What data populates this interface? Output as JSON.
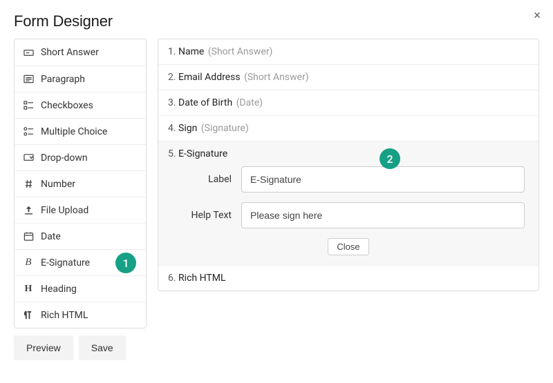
{
  "title": "Form Designer",
  "badges": {
    "one": "1",
    "two": "2"
  },
  "palette": [
    {
      "icon": "short-answer",
      "label": "Short Answer"
    },
    {
      "icon": "paragraph",
      "label": "Paragraph"
    },
    {
      "icon": "checkboxes",
      "label": "Checkboxes"
    },
    {
      "icon": "multiple",
      "label": "Multiple Choice"
    },
    {
      "icon": "dropdown",
      "label": "Drop-down"
    },
    {
      "icon": "number",
      "label": "Number"
    },
    {
      "icon": "upload",
      "label": "File Upload"
    },
    {
      "icon": "date",
      "label": "Date"
    },
    {
      "icon": "signature",
      "label": "E-Signature"
    },
    {
      "icon": "heading",
      "label": "Heading"
    },
    {
      "icon": "richhtml",
      "label": "Rich HTML"
    }
  ],
  "buttons": {
    "preview": "Preview",
    "save": "Save"
  },
  "fields": [
    {
      "num": "1.",
      "name": "Name",
      "type": "(Short Answer)"
    },
    {
      "num": "2.",
      "name": "Email Address",
      "type": "(Short Answer)"
    },
    {
      "num": "3.",
      "name": "Date of Birth",
      "type": "(Date)"
    },
    {
      "num": "4.",
      "name": "Sign",
      "type": "(Signature)"
    },
    {
      "num": "5.",
      "name": "E-Signature",
      "type": ""
    },
    {
      "num": "6.",
      "name": "Rich HTML",
      "type": ""
    }
  ],
  "editor": {
    "label_label": "Label",
    "label_value": "E-Signature",
    "help_label": "Help Text",
    "help_value": "Please sign here",
    "close": "Close"
  }
}
